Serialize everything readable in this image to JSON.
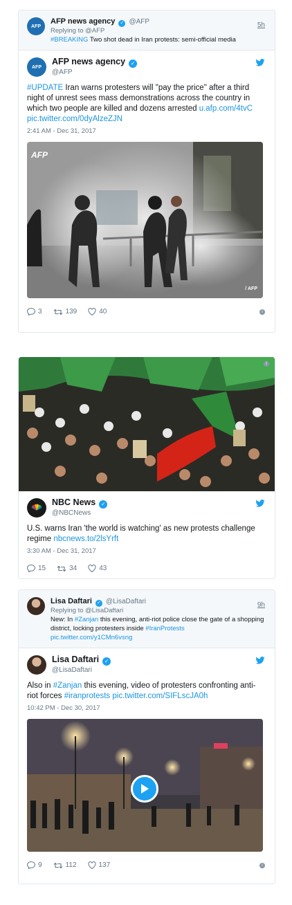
{
  "tweet1": {
    "reply": {
      "name": "AFP news agency",
      "handle": "@AFP",
      "time": "5h",
      "replying_to": "Replying to @AFP",
      "hashtag": "#BREAKING",
      "text": " Two shot dead in Iran protests: semi-official media"
    },
    "main": {
      "name": "AFP news agency",
      "handle": "@AFP",
      "hashtag": "#UPDATE",
      "text": " Iran warns protesters will \"pay the price\" after a third night of unrest sees mass demonstrations across the country in which two people are killed and dozens arrested ",
      "link1": "u.afp.com/4tvC",
      "link2": "pic.twitter.com/0dyAlzeZJN",
      "timestamp": "2:41 AM - Dec 31, 2017",
      "photo_logo": "AFP",
      "photo_credit": "/ AFP"
    },
    "actions": {
      "replies": "3",
      "retweets": "139",
      "likes": "40"
    }
  },
  "tweet2": {
    "name": "NBC News",
    "handle": "@NBCNews",
    "text": "U.S. warns Iran 'the world is watching' as new protests challenge regime ",
    "link": "nbcnews.to/2lsYrft",
    "timestamp": "3:30 AM - Dec 31, 2017",
    "actions": {
      "replies": "15",
      "retweets": "34",
      "likes": "43"
    }
  },
  "tweet3": {
    "reply": {
      "name": "Lisa Daftari",
      "handle": "@LisaDaftari",
      "time": "9h",
      "replying_to": "Replying to @LisaDaftari",
      "text_a": "New: In ",
      "hashtag_a": "#Zanjan",
      "text_b": " this evening, anti-riot police close the gate of a shopping district, locking protesters inside ",
      "hashtag_b": "#IranProtests",
      "link": "pic.twitter.com/y1CMn6vsng"
    },
    "main": {
      "name": "Lisa Daftari",
      "handle": "@LisaDaftari",
      "text_a": "Also in ",
      "hashtag_a": "#Zanjan",
      "text_b": " this evening, video of protesters confronting anti-riot forces ",
      "hashtag_b": "#iranprotests",
      "link": " pic.twitter.com/SIFLscJA0h",
      "timestamp": "10:42 PM - Dec 30, 2017"
    },
    "actions": {
      "replies": "9",
      "retweets": "112",
      "likes": "137"
    }
  },
  "colors": {
    "link": "#1b95e0",
    "verified": "#1da1f2",
    "muted": "#657786"
  },
  "icons": [
    "verified-badge-icon",
    "twitter-bird-icon",
    "reply-icon",
    "retweet-icon",
    "like-icon",
    "info-icon",
    "play-icon"
  ]
}
